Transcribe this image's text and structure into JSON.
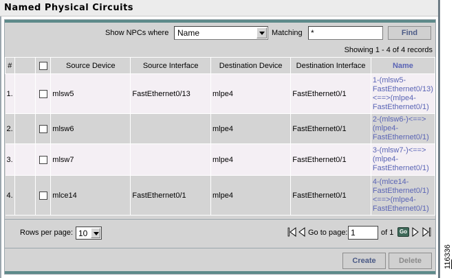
{
  "title": "Named Physical Circuits",
  "filter": {
    "show_label": "Show NPCs where",
    "field_value": "Name",
    "matching_label": "Matching",
    "matching_value": "*",
    "find_label": "Find"
  },
  "showing": "Showing 1 - 4 of 4 records",
  "table": {
    "headers": {
      "num": "#",
      "source_device": "Source Device",
      "source_interface": "Source Interface",
      "destination_device": "Destination Device",
      "destination_interface": "Destination Interface",
      "name": "Name"
    },
    "rows": [
      {
        "num": "1.",
        "source_device": "mlsw5",
        "source_interface": "FastEthernet0/13",
        "destination_device": "mlpe4",
        "destination_interface": "FastEthernet0/1",
        "name": [
          "1-(mlsw5-",
          "FastEthernet0/13)",
          "<==>(mlpe4-",
          "FastEthernet0/1)"
        ]
      },
      {
        "num": "2.",
        "source_device": "mlsw6",
        "source_interface": "",
        "destination_device": "mlpe4",
        "destination_interface": "FastEthernet0/1",
        "name": [
          "2-(mlsw6-)<==>",
          "(mlpe4-",
          "FastEthernet0/1)"
        ]
      },
      {
        "num": "3.",
        "source_device": "mlsw7",
        "source_interface": "",
        "destination_device": "mlpe4",
        "destination_interface": "FastEthernet0/1",
        "name": [
          "3-(mlsw7-)<==>",
          "(mlpe4-",
          "FastEthernet0/1)"
        ]
      },
      {
        "num": "4.",
        "source_device": "mlce14",
        "source_interface": "FastEthernet0/1",
        "destination_device": "mlpe4",
        "destination_interface": "FastEthernet0/1",
        "name": [
          "4-(mlce14-",
          "FastEthernet0/1)",
          "<==>(mlpe4-",
          "FastEthernet0/1)"
        ]
      }
    ]
  },
  "pager": {
    "rows_per_page_label": "Rows per page:",
    "rows_per_page_value": "10",
    "go_to_page_label": "Go to page:",
    "page_value": "1",
    "of_label": "of 1",
    "go_label": "Go"
  },
  "actions": {
    "create_label": "Create",
    "delete_label": "Delete"
  },
  "side_id": "116336",
  "colors": {
    "accent_link": "#5a64b5",
    "panel_bg": "#d4d4d4",
    "row_alt": "#f4eff4",
    "teal_rule": "#5d8a8a"
  }
}
